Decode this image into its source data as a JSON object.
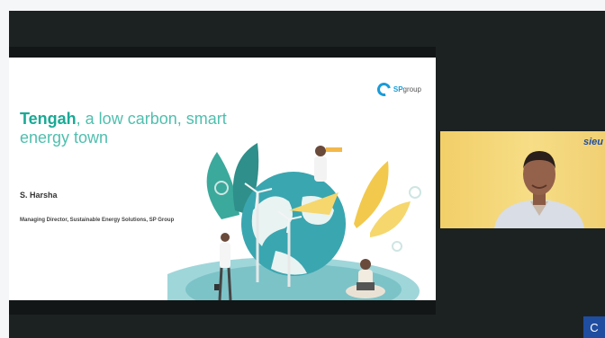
{
  "slide": {
    "logo_prefix": "SP",
    "logo_suffix": "group",
    "title_strong": "Tengah",
    "title_rest": ", a low carbon, smart energy town",
    "presenter": "S. Harsha",
    "role": "Managing Director, Sustainable Energy Solutions, SP Group"
  },
  "webcam": {
    "logo": "sieu"
  },
  "controls": {
    "corner_button": "C"
  },
  "colors": {
    "meeting_bg": "#1c2222",
    "title_teal": "#1aa995",
    "sp_blue": "#1a9bd8",
    "webcam_bg": "#f2cf68",
    "button_blue": "#1f4ea1"
  }
}
